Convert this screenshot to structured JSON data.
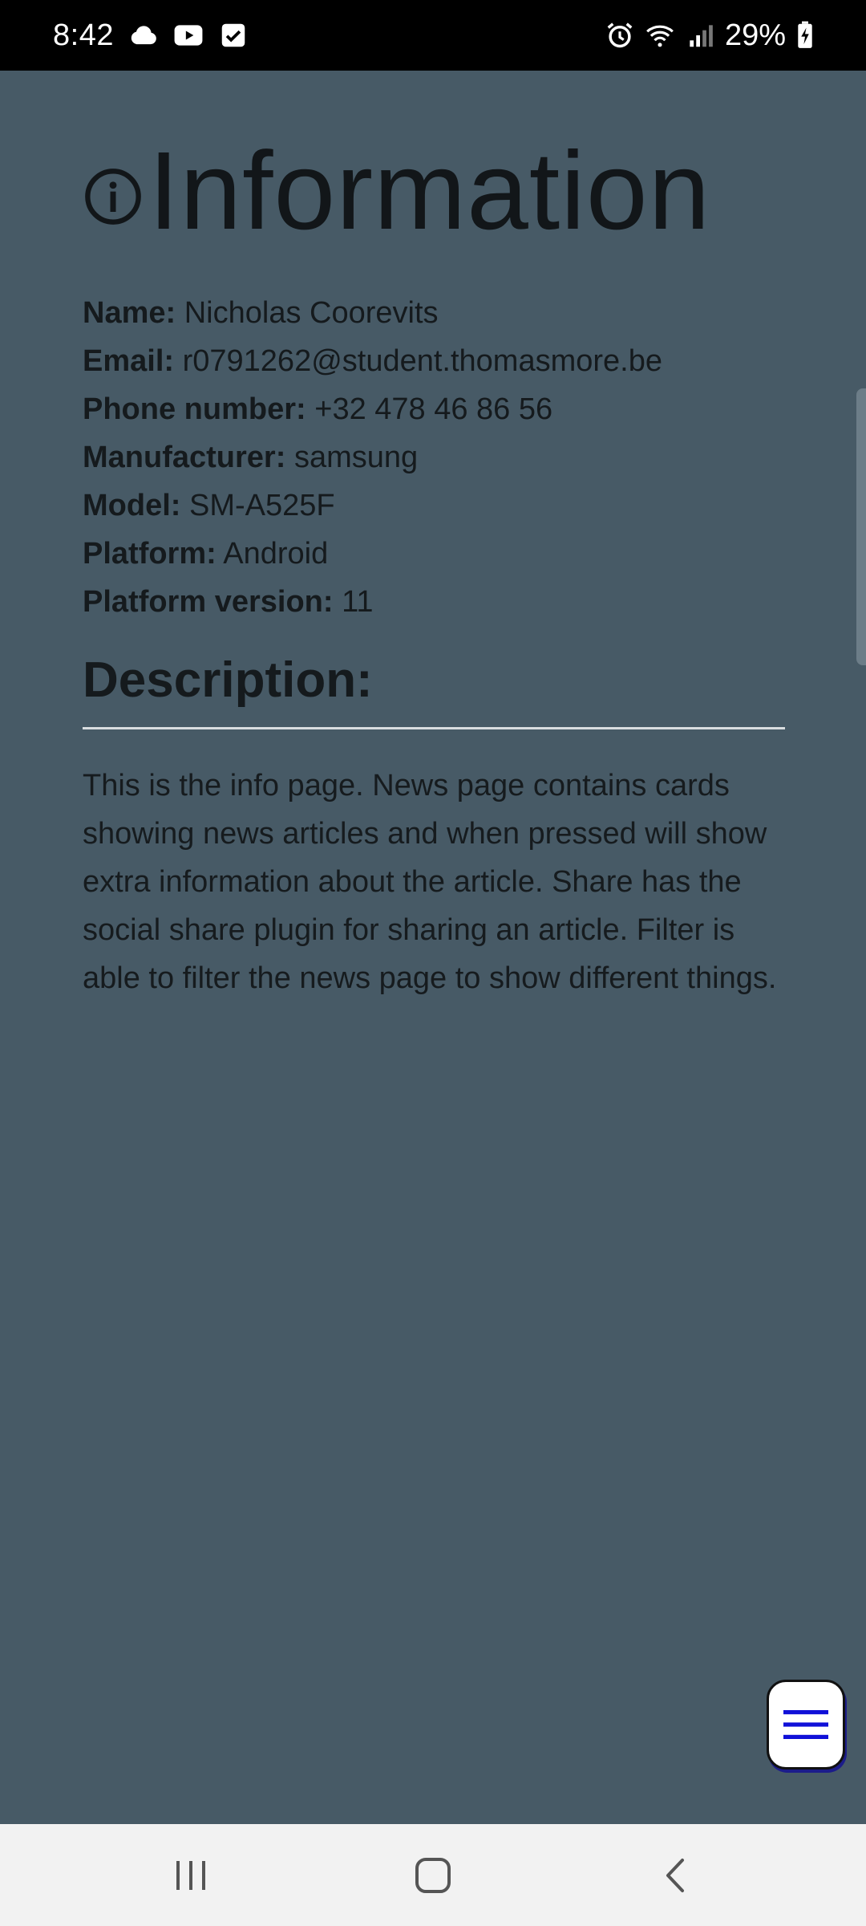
{
  "status_bar": {
    "time": "8:42",
    "left_icons": [
      "cloud-icon",
      "youtube-icon",
      "checkbox-icon"
    ],
    "right_icons": [
      "alarm-icon",
      "wifi-icon",
      "signal-icon",
      "battery-charging-icon"
    ],
    "battery": "29%"
  },
  "page": {
    "title": "Information",
    "title_icon": "info-circle-icon",
    "info": [
      {
        "label": "Name:",
        "value": "Nicholas Coorevits"
      },
      {
        "label": "Email:",
        "value": "r0791262@student.thomasmore.be"
      },
      {
        "label": "Phone number:",
        "value": "+32 478 46 86 56"
      },
      {
        "label": "Manufacturer:",
        "value": "samsung"
      },
      {
        "label": "Model:",
        "value": "SM-A525F"
      },
      {
        "label": "Platform:",
        "value": "Android"
      },
      {
        "label": "Platform version:",
        "value": "11"
      }
    ],
    "description_heading": "Description:",
    "description": "This is the info page. News page contains cards showing news articles and when pressed will show extra information about the article. Share has the social share plugin for sharing an article. Filter is able to filter the news page to show different things."
  },
  "fab": {
    "icon": "menu-icon"
  },
  "nav_bar": {
    "buttons": [
      "recent-apps-icon",
      "home-icon",
      "back-icon"
    ]
  },
  "colors": {
    "background": "#475a66",
    "status_bar": "#000000",
    "nav_bar": "#f2f2f2",
    "fab_icon": "#1010d8"
  }
}
